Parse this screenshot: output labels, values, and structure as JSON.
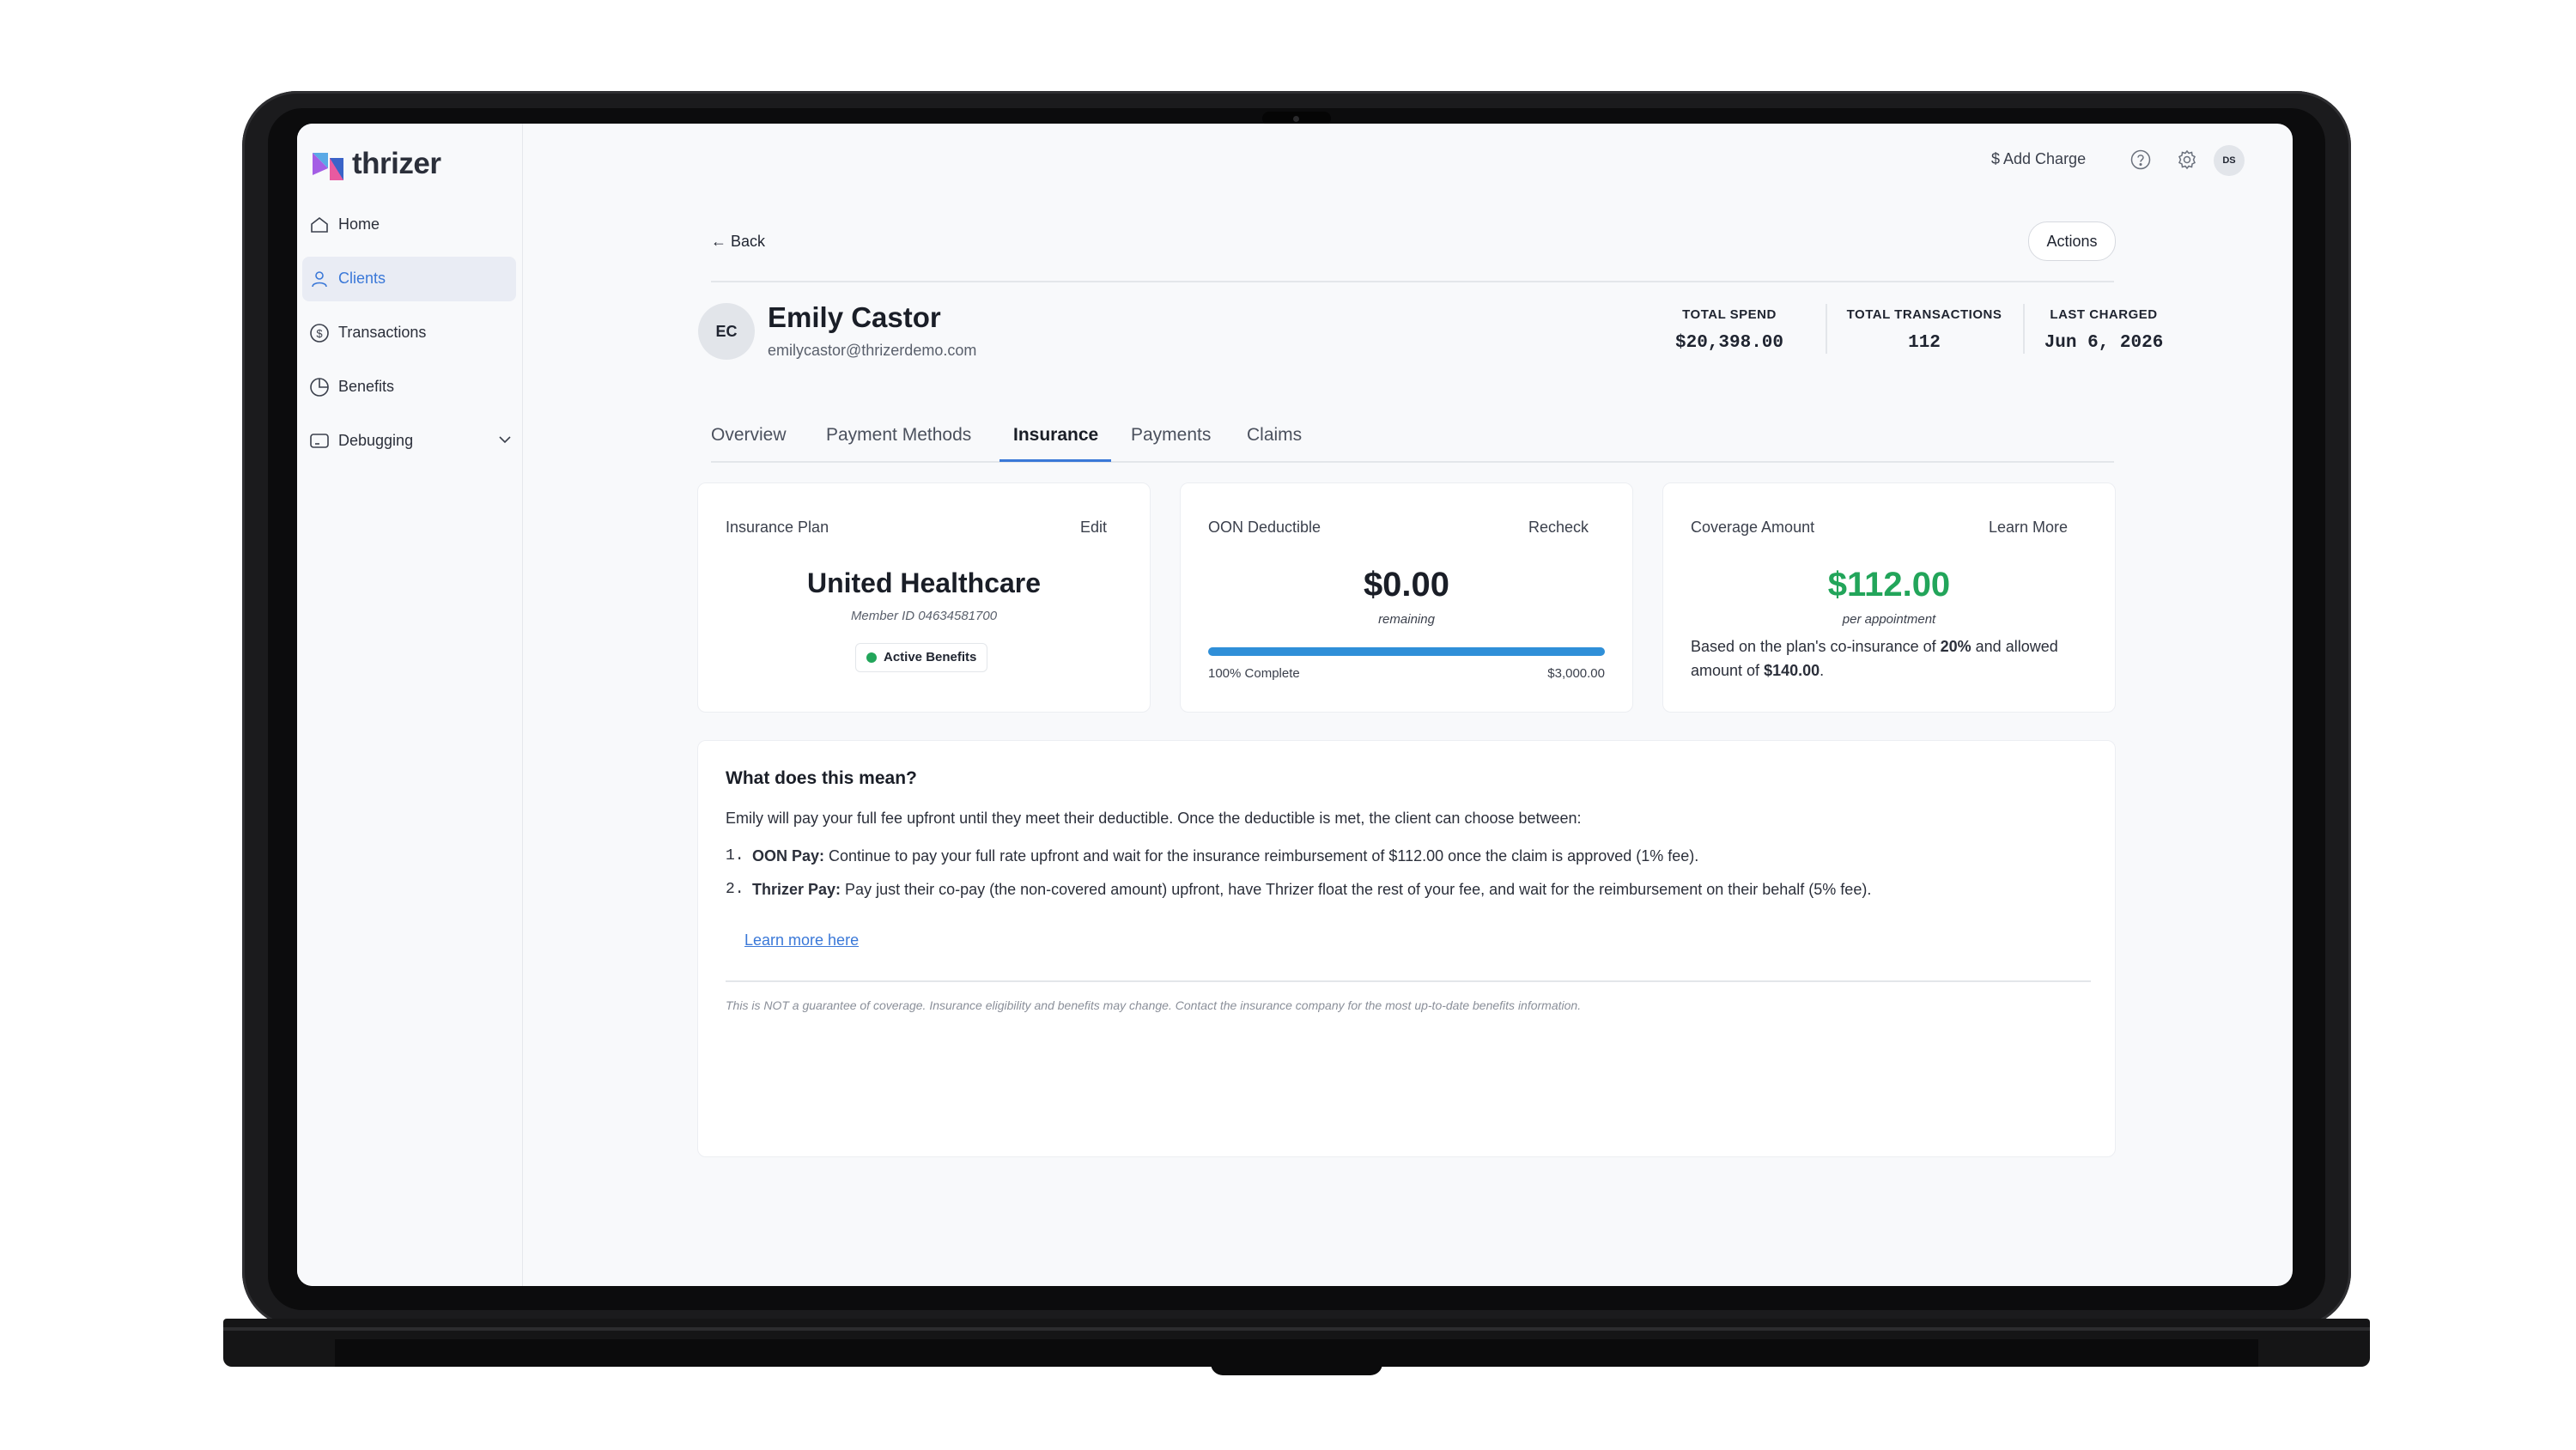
{
  "app": {
    "brand": "thrizer"
  },
  "sidebar": {
    "items": [
      {
        "label": "Home",
        "icon": "home-icon"
      },
      {
        "label": "Clients",
        "icon": "user-icon",
        "active": true
      },
      {
        "label": "Transactions",
        "icon": "dollar-circle-icon"
      },
      {
        "label": "Benefits",
        "icon": "pie-chart-icon"
      },
      {
        "label": "Debugging",
        "icon": "monitor-icon",
        "expandable": true
      }
    ]
  },
  "topbar": {
    "add_charge": "$ Add Charge",
    "help_icon": "help-icon",
    "settings_icon": "gear-icon",
    "avatar_initials": "DS"
  },
  "header": {
    "back": "← Back",
    "actions": "Actions",
    "client": {
      "initials": "EC",
      "name": "Emily Castor",
      "email": "emilycastor@thrizerdemo.com"
    },
    "stats": [
      {
        "label": "TOTAL SPEND",
        "value": "$20,398.00"
      },
      {
        "label": "TOTAL TRANSACTIONS",
        "value": "112"
      },
      {
        "label": "LAST CHARGED",
        "value": "Jun 6, 2026"
      }
    ]
  },
  "tabs": [
    {
      "label": "Overview"
    },
    {
      "label": "Payment Methods"
    },
    {
      "label": "Insurance",
      "active": true
    },
    {
      "label": "Payments"
    },
    {
      "label": "Claims"
    }
  ],
  "cards": {
    "plan": {
      "title": "Insurance Plan",
      "action": "Edit",
      "name": "United Healthcare",
      "member_id": "Member ID 04634581700",
      "badge": "Active Benefits",
      "badge_color": "#22a55a"
    },
    "deductible": {
      "title": "OON Deductible",
      "action": "Recheck",
      "amount": "$0.00",
      "amount_sub": "remaining",
      "progress": 1.0,
      "progress_label": "100% Complete",
      "total": "$3,000.00",
      "bar_color": "#2f8fd8"
    },
    "coverage": {
      "title": "Coverage Amount",
      "action": "Learn More",
      "amount": "$112.00",
      "amount_color": "#22a55a",
      "amount_sub": "per appointment",
      "desc_1": "Based on the plan's co-insurance of ",
      "desc_pct": "20%",
      "desc_2": " and allowed",
      "desc_3": "amount of ",
      "desc_allowed": "$140.00",
      "desc_4": "."
    }
  },
  "explain": {
    "title": "What does this mean?",
    "intro": "Emily will pay your full fee upfront until they meet their deductible. Once the deductible is met, the client can choose between:",
    "items": [
      {
        "num": "1.",
        "term": "OON Pay:",
        "text": " Continue to pay your full rate upfront and wait for the insurance reimbursement of $112.00 once the claim is approved (1% fee)."
      },
      {
        "num": "2.",
        "term": "Thrizer Pay:",
        "text": " Pay just their co-pay (the non-covered amount) upfront, have Thrizer float the rest of your fee, and wait for the reimbursement on their behalf (5% fee)."
      }
    ],
    "link": "Learn more here",
    "disclaimer": "This is NOT a guarantee of coverage. Insurance eligibility and benefits may change. Contact the insurance company for the most up-to-date benefits information."
  }
}
